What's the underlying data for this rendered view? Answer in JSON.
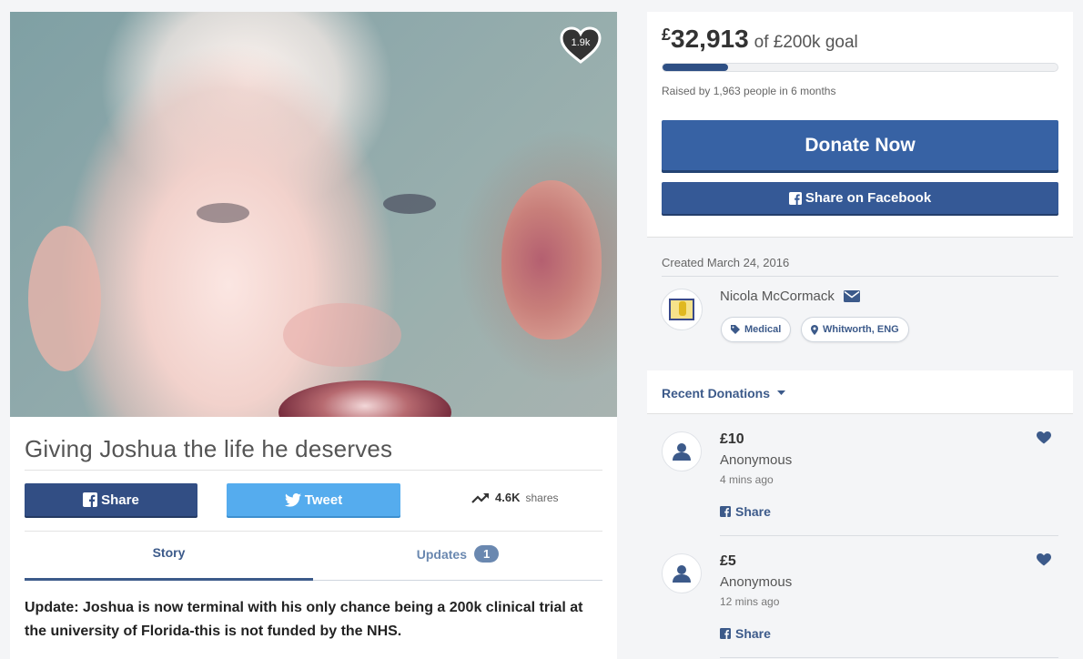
{
  "campaign": {
    "hero_likes": "1.9k",
    "title": "Giving Joshua the life he deserves",
    "share_label": "Share",
    "tweet_label": "Tweet",
    "shares_count": "4.6K",
    "shares_label": "shares",
    "tabs": [
      {
        "label": "Story",
        "active": true
      },
      {
        "label": "Updates",
        "badge": "1",
        "active": false
      }
    ],
    "story_text": "Update: Joshua is now terminal with his only chance being a 200k clinical trial at the university of Florida-this is not funded by the NHS."
  },
  "funding": {
    "currency": "£",
    "raised": "32,913",
    "goal_text": "of £200k goal",
    "progress_fraction": 0.165,
    "raised_by": "Raised by 1,963 people in 6 months",
    "donate_label": "Donate Now",
    "facebook_share_label": "Share on Facebook"
  },
  "organizer": {
    "created": "Created March 24, 2016",
    "name": "Nicola McCormack",
    "tags": [
      {
        "label": "Medical",
        "icon": "tag-icon"
      },
      {
        "label": "Whitworth, ENG",
        "icon": "map-pin-icon"
      }
    ]
  },
  "recent": {
    "title": "Recent Donations",
    "donations": [
      {
        "amount": "£10",
        "name": "Anonymous",
        "time": "4 mins ago",
        "share_label": "Share"
      },
      {
        "amount": "£5",
        "name": "Anonymous",
        "time": "12 mins ago",
        "share_label": "Share"
      }
    ]
  },
  "colors": {
    "brand": "#3762a4",
    "facebook": "#324e84",
    "twitter": "#55acee",
    "link": "#3c5a8a"
  }
}
